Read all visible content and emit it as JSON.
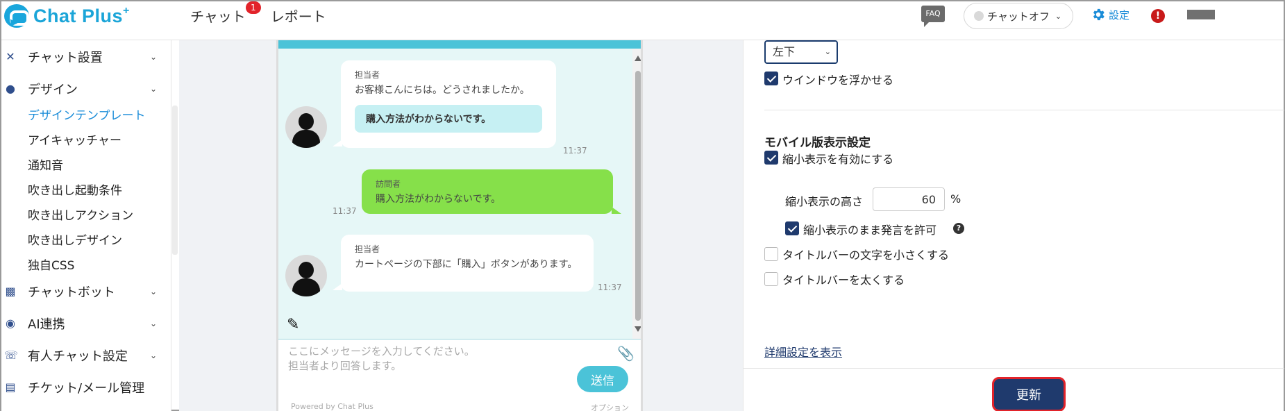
{
  "header": {
    "logo_text": "Chat Plus",
    "logo_sup": "+",
    "nav": [
      {
        "label": "チャット",
        "badge": "1"
      },
      {
        "label": "レポート",
        "badge": ""
      }
    ],
    "faq": "FAQ",
    "status": "チャットオフ",
    "settings": "設定",
    "alert": "!"
  },
  "sidebar": {
    "groups": [
      {
        "label": "チャット設置",
        "icon": "tools-icon"
      },
      {
        "label": "デザイン",
        "icon": "palette-icon"
      },
      {
        "label": "チャットボット",
        "icon": "chat-bubble-icon"
      },
      {
        "label": "AI連携",
        "icon": "ai-icon"
      },
      {
        "label": "有人チャット設定",
        "icon": "headset-icon"
      },
      {
        "label": "チケット/メール管理",
        "icon": "ticket-icon"
      }
    ],
    "design_items": [
      "デザインテンプレート",
      "アイキャッチャー",
      "通知音",
      "吹き出し起動条件",
      "吹き出しアクション",
      "吹き出しデザイン",
      "独自CSS"
    ],
    "active_item": "デザインテンプレート"
  },
  "preview": {
    "messages": [
      {
        "from": "担当者",
        "text": "お客様こんにちは。どうされましたか。",
        "quick_reply": "購入方法がわからないです。",
        "time": "11:37"
      },
      {
        "from": "訪問者",
        "text": "購入方法がわからないです。",
        "time": "11:37"
      },
      {
        "from": "担当者",
        "text": "カートページの下部に「購入」ボタンがあります。",
        "time": "11:37"
      }
    ],
    "input_placeholder": "ここにメッセージを入力してください。\n担当者より回答します。",
    "send_label": "送信",
    "powered": "Powered by Chat Plus",
    "option": "オプション"
  },
  "settings_panel": {
    "position_value": "左下",
    "float_window": {
      "label": "ウインドウを浮かせる",
      "checked": true
    },
    "mobile_section_title": "モバイル版表示設定",
    "shrink_enable": {
      "label": "縮小表示を有効にする",
      "checked": true
    },
    "shrink_height_label": "縮小表示の高さ",
    "shrink_height_value": "60",
    "shrink_height_unit": "%",
    "allow_speak": {
      "label": "縮小表示のまま発言を許可",
      "checked": true
    },
    "small_title": {
      "label": "タイトルバーの文字を小さくする",
      "checked": false
    },
    "bold_title": {
      "label": "タイトルバーを太くする",
      "checked": false
    },
    "advanced_link": "詳細設定を表示",
    "update_label": "更新"
  },
  "colors": {
    "brand": "#1ba5d8",
    "navy": "#1f3a6d",
    "visitor_bubble": "#86e04a",
    "chat_bg": "#e6f7f7",
    "accent_red": "#e2232a"
  }
}
